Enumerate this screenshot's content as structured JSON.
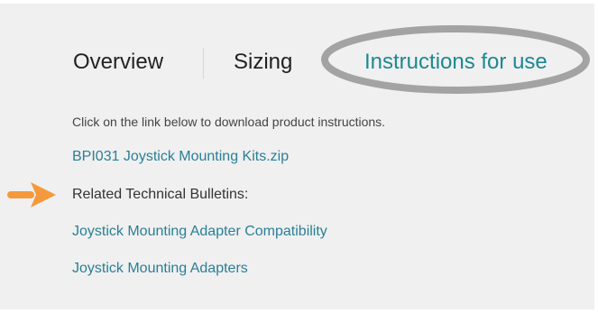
{
  "tabs": {
    "overview_label": "Overview",
    "sizing_label": "Sizing",
    "instructions_label": "Instructions for use"
  },
  "content": {
    "intro_text": "Click on the link below to download product instructions.",
    "download_link": "BPI031 Joystick Mounting Kits.zip",
    "bulletins_label": "Related Technical Bulletins:",
    "bulletin_links": [
      "Joystick Mounting Adapter Compatibility",
      "Joystick Mounting Adapters"
    ]
  },
  "colors": {
    "panel_background": "#f0f0f0",
    "link": "#2a7f96",
    "active_tab": "#1e8891",
    "highlight_ring": "#a3a3a3",
    "pointer_arrow": "#f59a3c"
  },
  "icons": {
    "pointer": "arrow-right-icon"
  }
}
